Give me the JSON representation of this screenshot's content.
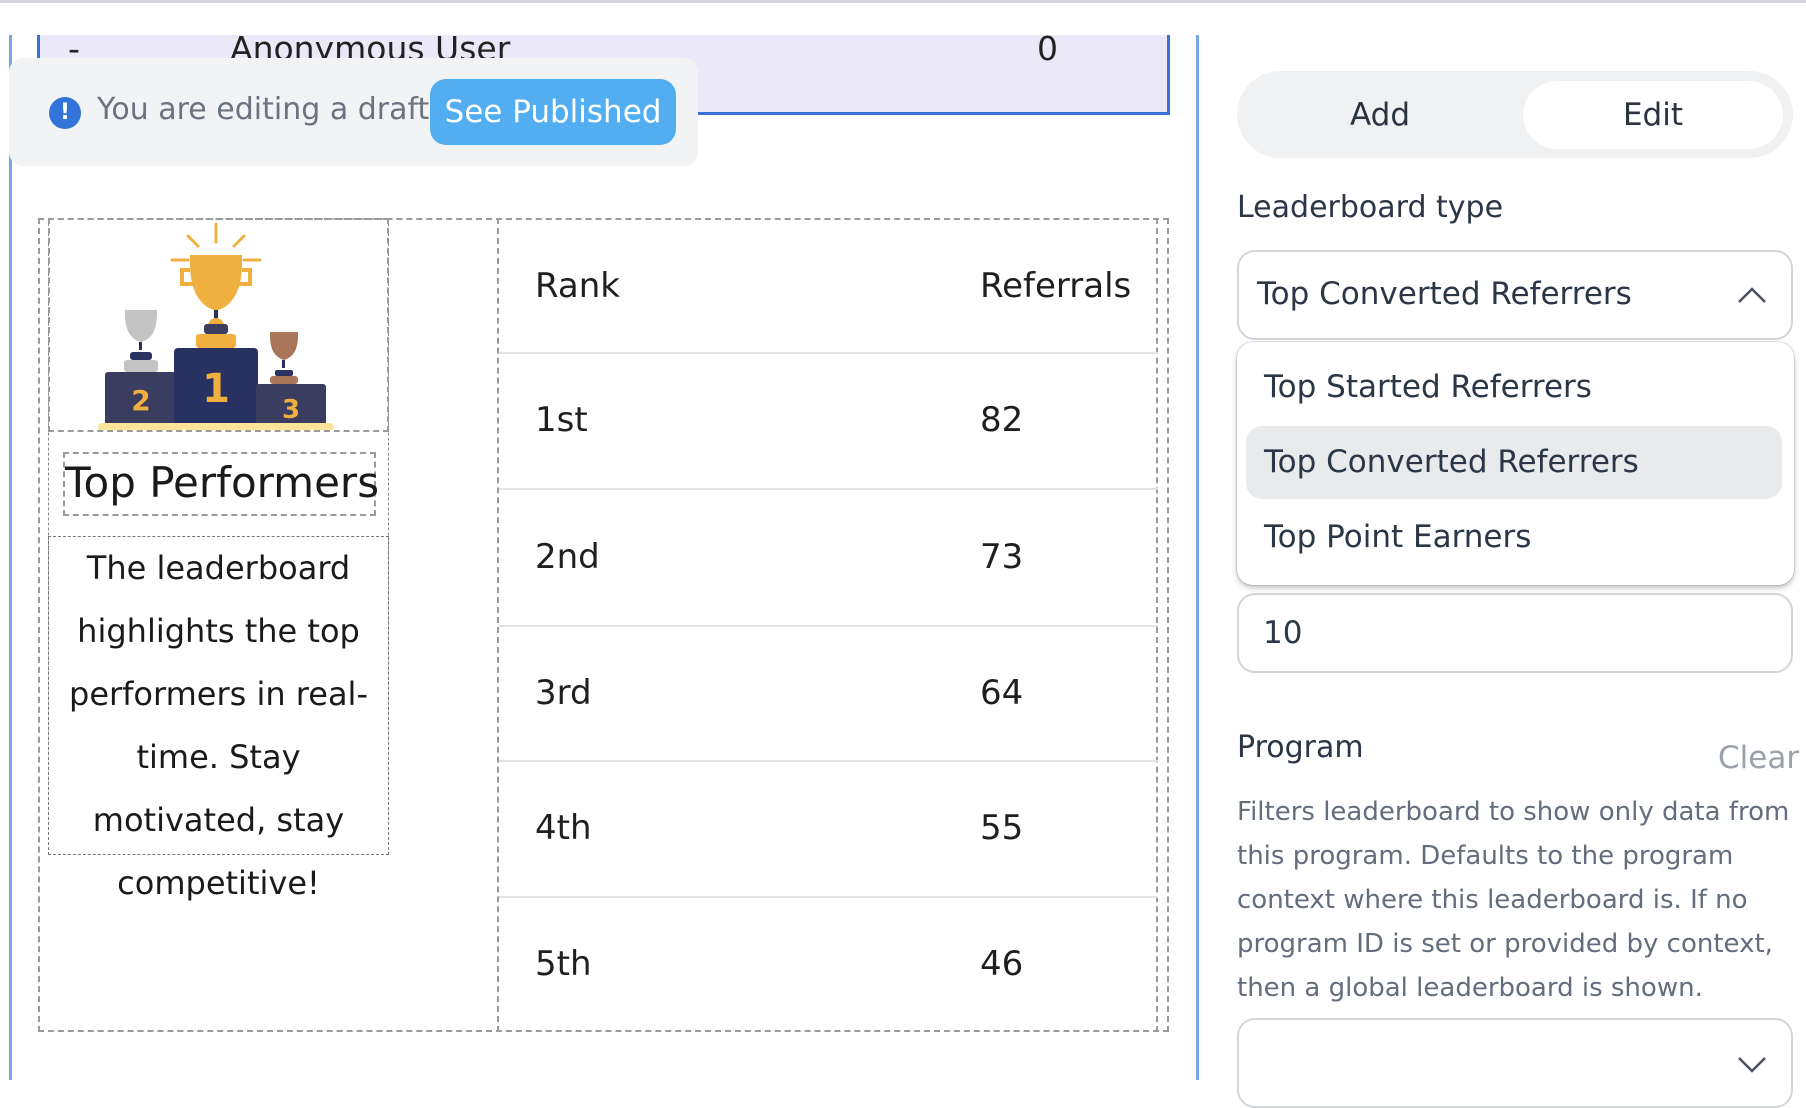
{
  "preview": {
    "anon_row": {
      "rank": "-",
      "name": "Anonymous User",
      "value": "0"
    },
    "draft_banner": {
      "message": "You are editing a draft",
      "button": "See Published",
      "icon": "info-icon"
    },
    "widget": {
      "title": "Top Performers",
      "description": "The leaderboard highlights the top performers in real-time. Stay motivated, stay competitive!",
      "image": "podium-trophies",
      "table": {
        "headers": [
          "Rank",
          "Referrals"
        ],
        "rows": [
          [
            "1st",
            "82"
          ],
          [
            "2nd",
            "73"
          ],
          [
            "3rd",
            "64"
          ],
          [
            "4th",
            "55"
          ],
          [
            "5th",
            "46"
          ]
        ]
      }
    }
  },
  "panel": {
    "tabs": [
      {
        "label": "Add",
        "active": false
      },
      {
        "label": "Edit",
        "active": true
      }
    ],
    "leaderboard_type": {
      "label": "Leaderboard type",
      "value": "Top Converted Referrers",
      "options": [
        "Top Started Referrers",
        "Top Converted Referrers",
        "Top Point Earners"
      ]
    },
    "count_value": "10",
    "program": {
      "label": "Program",
      "clear": "Clear",
      "description": "Filters leaderboard to show only data from this program. Defaults to the program context where this leaderboard is. If no program ID is set or provided by context, then a global leaderboard is shown.",
      "value": ""
    }
  },
  "colors": {
    "accent": "#52adf1",
    "info": "#3274d9",
    "selection_border": "#3a73d6",
    "trophy_gold": "#f0b03f",
    "podium": "#2a3262"
  }
}
